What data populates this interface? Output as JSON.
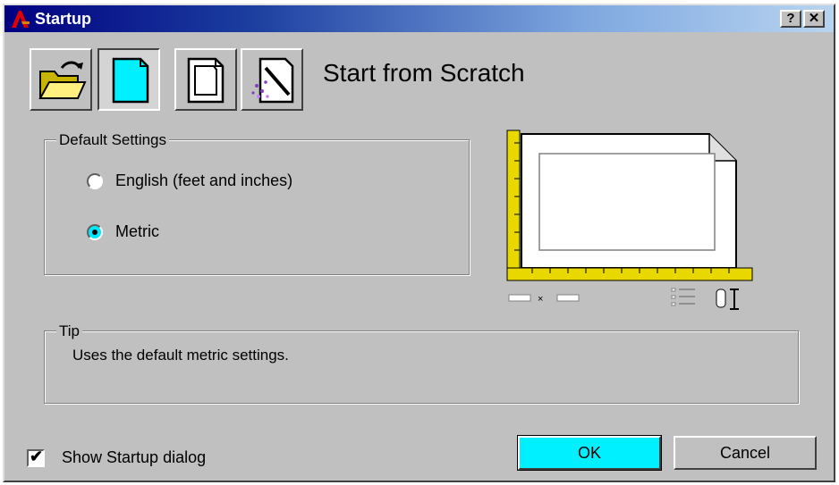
{
  "window": {
    "title": "Startup",
    "help_glyph": "?",
    "close_glyph": "✕"
  },
  "toolbar": {
    "buttons": [
      {
        "icon": "open-folder-icon",
        "label": "Open a Drawing"
      },
      {
        "icon": "blank-page-icon",
        "label": "Start from Scratch",
        "pressed": true
      },
      {
        "icon": "template-page-icon",
        "label": "Use a Template"
      },
      {
        "icon": "wizard-page-icon",
        "label": "Use a Wizard"
      }
    ]
  },
  "heading": "Start from Scratch",
  "default_settings": {
    "legend": "Default Settings",
    "options": [
      {
        "label": "English (feet and inches)",
        "selected": false
      },
      {
        "label": "Metric",
        "selected": true
      }
    ]
  },
  "tip": {
    "legend": "Tip",
    "text": "Uses the default metric settings."
  },
  "footer": {
    "show_startup_label": "Show Startup dialog",
    "show_startup_checked": true,
    "check_glyph": "✔",
    "ok_label": "OK",
    "cancel_label": "Cancel"
  },
  "colors": {
    "accent": "#00f0ff",
    "face": "#c0c0c0",
    "title_start": "#000080",
    "ruler": "#e8d800"
  }
}
